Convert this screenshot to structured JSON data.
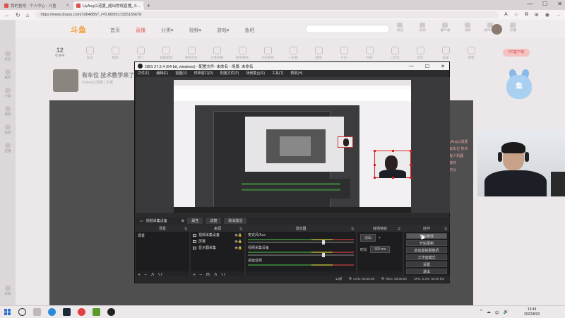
{
  "browser": {
    "tabs": [
      {
        "label": "我的鱼吧 - 个人中心 - 斗鱼",
        "active": false
      },
      {
        "label": "UyAng以道夏_超出常规直播_斗...",
        "active": true
      }
    ],
    "new_tab": "+",
    "url": "https://www.douyu.com/10648857_r=5.66/9517325155678",
    "window_controls": [
      "—",
      "☐",
      "✕"
    ]
  },
  "site": {
    "logo": "斗鱼",
    "nav": [
      "首页",
      "直播",
      "分类▾",
      "视频▾",
      "游戏▾",
      "鱼吧"
    ],
    "top_icons": [
      "关注",
      "历史",
      "客户端",
      "消息",
      "创作中心",
      "开播"
    ],
    "rail": [
      "关注",
      "推荐",
      "分类",
      "视频",
      "鱼吧",
      "直播",
      "客服"
    ]
  },
  "category_row": {
    "count": "12",
    "count_label": "在线中",
    "items": [
      "关注",
      "推荐",
      "热门",
      "英雄联盟",
      "绝地求生",
      "王者荣耀",
      "和平精英",
      "主机游戏",
      "一起看",
      "颜值",
      "户外",
      "科技",
      "二次元",
      "音乐",
      "美食",
      "游戏"
    ],
    "pc_button": "PC客户端"
  },
  "room": {
    "title": "有车位 技术教学来了",
    "author": "UyAng以道夏 | 王者"
  },
  "mascot": "鱼",
  "chat_lines": [
    "...yAng以道夏",
    "...有车位 技术",
    "...有人机器",
    "...来的",
    "...可以"
  ],
  "obs": {
    "title": "OBS 27.2.4 (64-bit, windows) - 配置文件: 未命名 - 场景: 未命名",
    "menu": [
      "文件(F)",
      "编辑(E)",
      "视图(V)",
      "停靠窗口(D)",
      "配置文件(P)",
      "场景集合(S)",
      "工具(T)",
      "帮助(H)"
    ],
    "source_bar": {
      "selected": "视频采集设备",
      "props": "属性",
      "filters": "滤镜",
      "deactivate": "取消激活"
    },
    "scenes": {
      "header": "场景",
      "items": [
        "场景"
      ]
    },
    "sources": {
      "header": "来源",
      "items": [
        "视频采集设备",
        "屏幕",
        "显示器采集"
      ]
    },
    "mixer": {
      "header": "混音器",
      "channels": [
        {
          "name": "麦克风/Aux",
          "db": "0.0 dB"
        },
        {
          "name": "视频采集设备",
          "db": "0.0 dB"
        },
        {
          "name": "桌面音频",
          "db": "0.0 dB"
        }
      ]
    },
    "transitions": {
      "header": "转场特效",
      "type": "淡出",
      "duration_label": "时长",
      "duration": "300 ms"
    },
    "controls": {
      "header": "控件",
      "buttons": [
        "开始推流",
        "开始录制",
        "启动虚拟摄像机",
        "工作室模式",
        "设置",
        "退出"
      ]
    },
    "status": {
      "live": "LIVE: 00:00:00",
      "rec": "REC: 00:00:00",
      "cpu": "CPU: 2.3%, 60.00 fps",
      "dropped": "12帧"
    }
  },
  "taskbar": {
    "tray": [
      "^",
      "☁",
      "中",
      "🔊"
    ],
    "time": "13:44",
    "date": "2022/8/20"
  }
}
